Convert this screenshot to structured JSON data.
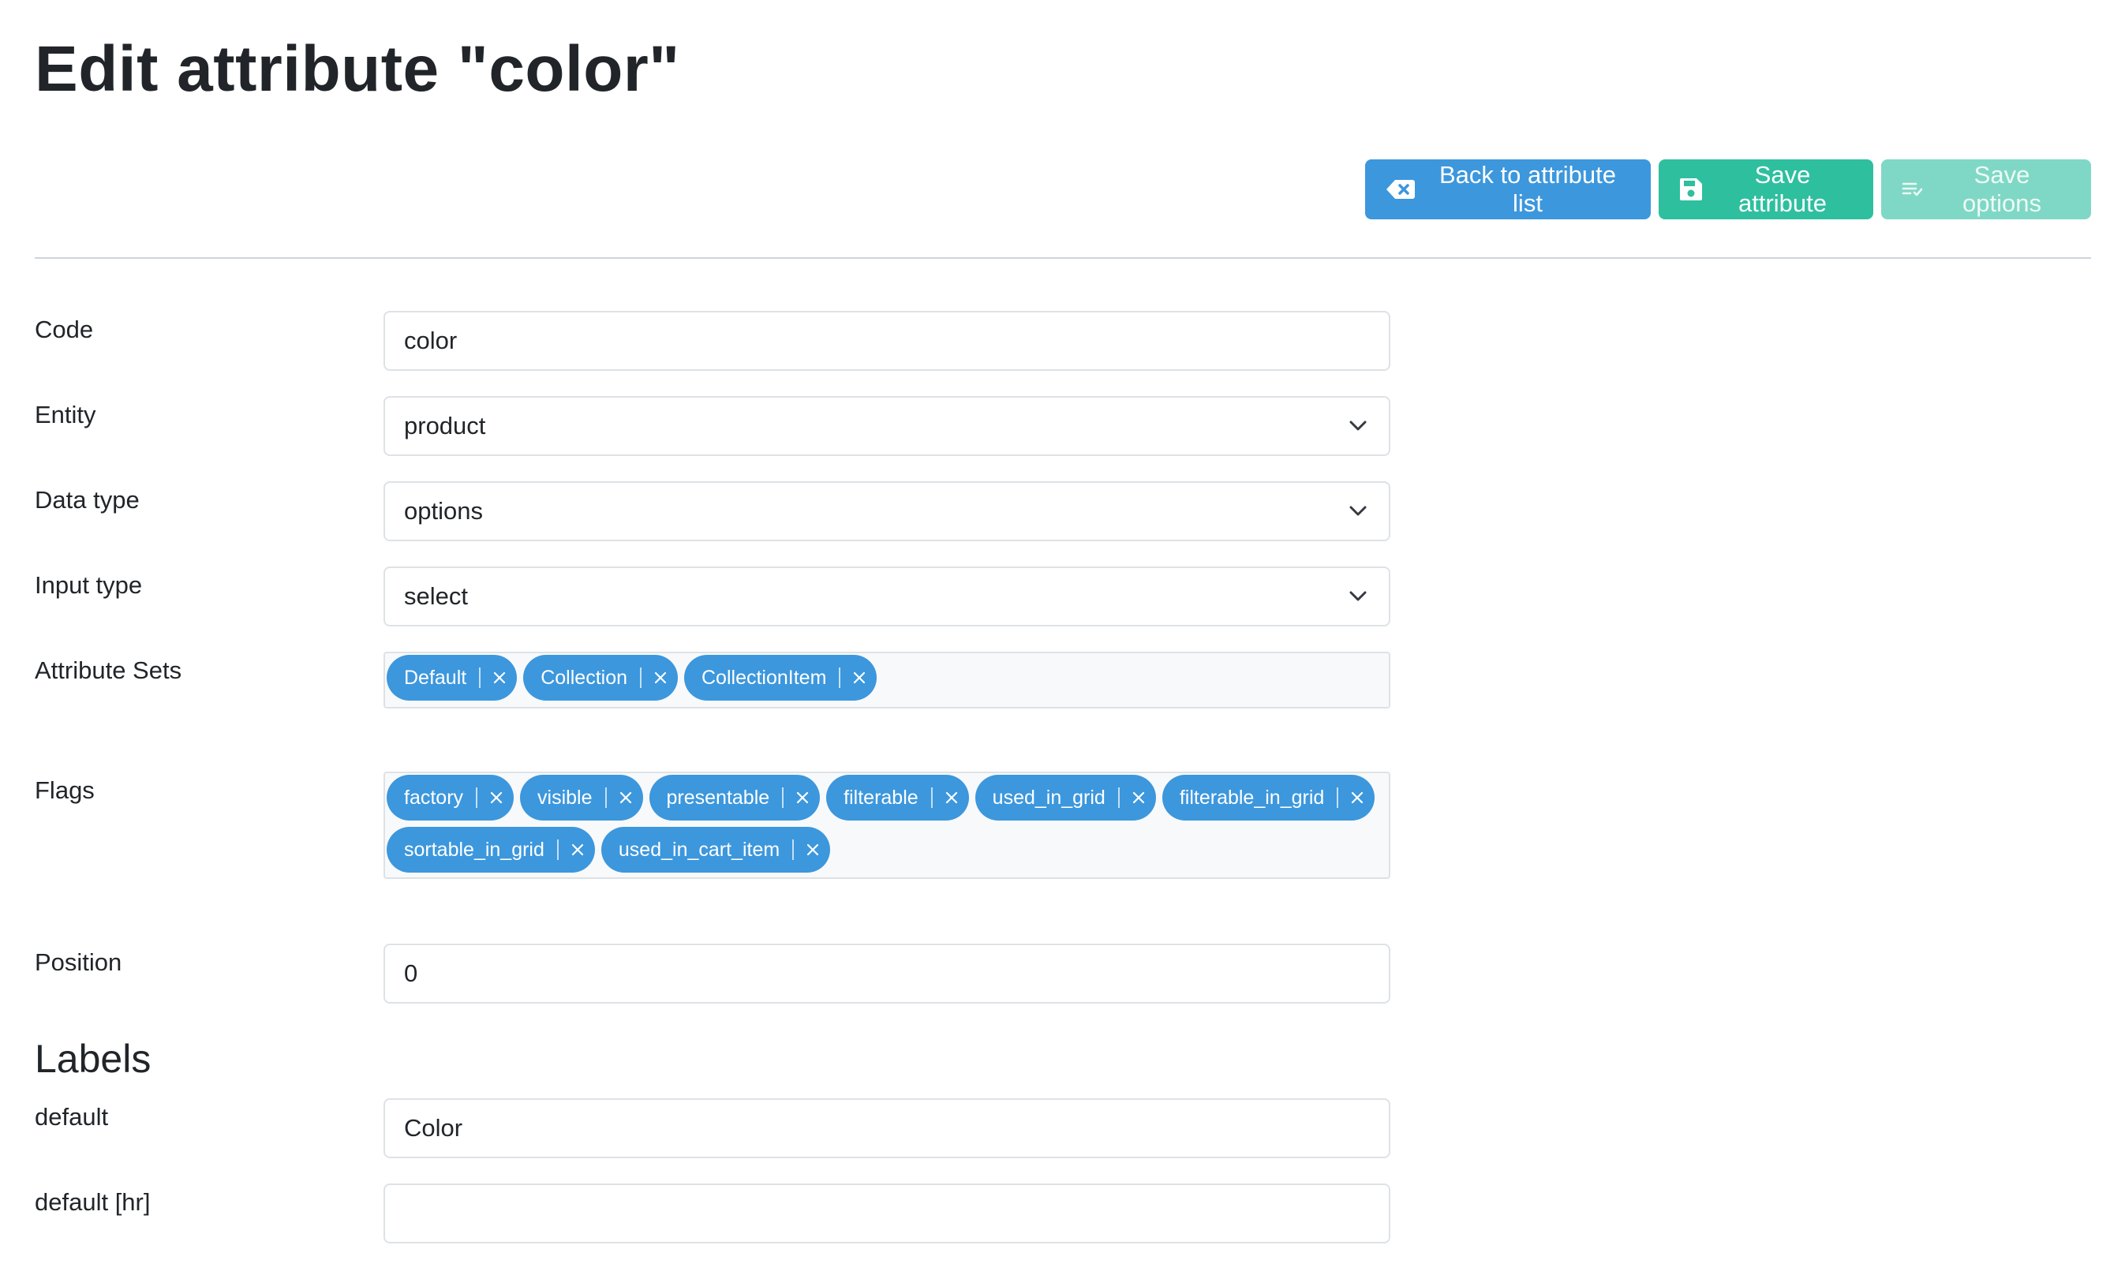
{
  "page": {
    "title": "Edit attribute \"color\""
  },
  "toolbar": {
    "back_label": "Back to attribute list",
    "save_label": "Save attribute",
    "options_label": "Save options"
  },
  "form": {
    "code": {
      "label": "Code",
      "value": "color"
    },
    "entity": {
      "label": "Entity",
      "value": "product"
    },
    "data_type": {
      "label": "Data type",
      "value": "options"
    },
    "input_type": {
      "label": "Input type",
      "value": "select"
    },
    "attribute_sets": {
      "label": "Attribute Sets",
      "tags": [
        "Default",
        "Collection",
        "CollectionItem"
      ]
    },
    "flags": {
      "label": "Flags",
      "tags": [
        "factory",
        "visible",
        "presentable",
        "filterable",
        "used_in_grid",
        "filterable_in_grid",
        "sortable_in_grid",
        "used_in_cart_item"
      ]
    },
    "position": {
      "label": "Position",
      "value": "0"
    }
  },
  "labels": {
    "title": "Labels",
    "default": {
      "label": "default",
      "value": "Color"
    },
    "default_hr": {
      "label": "default [hr]",
      "value": ""
    }
  },
  "colors": {
    "primary": "#3c97dd",
    "success": "#2ebf9f",
    "success_disabled": "#7fd8c5",
    "border": "#dee2e6"
  },
  "icons": {
    "back": "backspace-icon",
    "save": "floppy-disk-icon",
    "options": "list-icon",
    "select": "chevron-down-icon",
    "tag_remove": "close-icon"
  }
}
